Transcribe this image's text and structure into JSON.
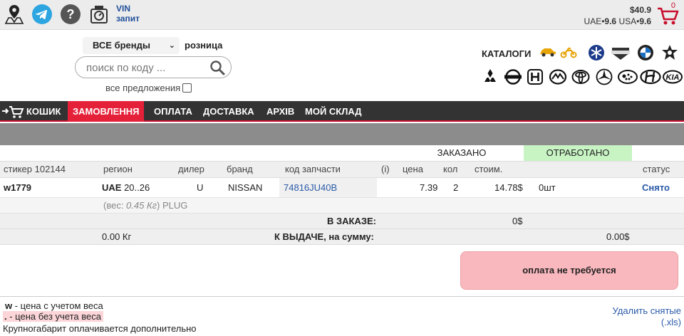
{
  "topbar": {
    "vin_line1": "VIN",
    "vin_line2": "запит",
    "balance": "$40.9",
    "rate_uae_label": "UAE•",
    "rate_uae_value": "9.6",
    "rate_usa_label": "USA•",
    "rate_usa_value": "9.6",
    "cart_count": "0"
  },
  "search": {
    "brand_select": "ВСЕ бренды",
    "price_type": "розница",
    "placeholder": "поиск по коду ...",
    "all_offers_label": "все предложения"
  },
  "catalogs": {
    "label": "КАТАЛОГИ"
  },
  "nav": {
    "items": [
      "КОШИК",
      "ЗАМОВЛЕННЯ",
      "ОПЛАТА",
      "ДОСТАВКА",
      "АРХІВ",
      "МОЙ СКЛАД"
    ],
    "active_index": 1
  },
  "table": {
    "group_ordered": "ЗАКАЗАНО",
    "group_worked": "ОТРАБОТАНО",
    "columns": {
      "sticker": "стикер 102144",
      "region": "регион",
      "dealer": "дилер",
      "brand": "бранд",
      "part_code": "код запчасти",
      "info": "(i)",
      "price": "цена",
      "qty": "кол",
      "cost": "стоим.",
      "status": "статус"
    },
    "row": {
      "sticker": "w1779",
      "region_code": "UAE",
      "region_days": " 20..26",
      "dealer": "U",
      "brand": "NISSAN",
      "part_code": "74816JU40B",
      "price": "7.39",
      "qty": "2",
      "cost": "14.78$",
      "worked": "0шт",
      "status": "Снято"
    },
    "detail": {
      "weight_prefix": "(вес: ",
      "weight_value": "0.45 Кг",
      "weight_suffix": ") PLUG"
    },
    "in_order_label": "В ЗАКАЗЕ:",
    "in_order_value": "0$",
    "issue_weight": "0.00 Кг",
    "issue_label": "К ВЫДАЧЕ, на сумму:",
    "issue_value": "0.00$"
  },
  "payment": {
    "status": "оплата не требуется"
  },
  "legend": {
    "w_key": "w",
    "w_text": " - цена с учетом веса",
    "dot_key": ".",
    "dot_text": " - цена без учета веса",
    "oversize": "Крупногабарит оплачивается дополнительно"
  },
  "actions": {
    "delete_removed_line1": "Удалить снятые",
    "delete_removed_line2": "(.xls)"
  },
  "colors": {
    "nav_bg": "#333333",
    "nav_active": "#e5213a",
    "worked_bg": "#c8f4c4",
    "pay_box": "#f9b8be",
    "link": "#2a5aa8",
    "cart_red": "#c8102e"
  }
}
